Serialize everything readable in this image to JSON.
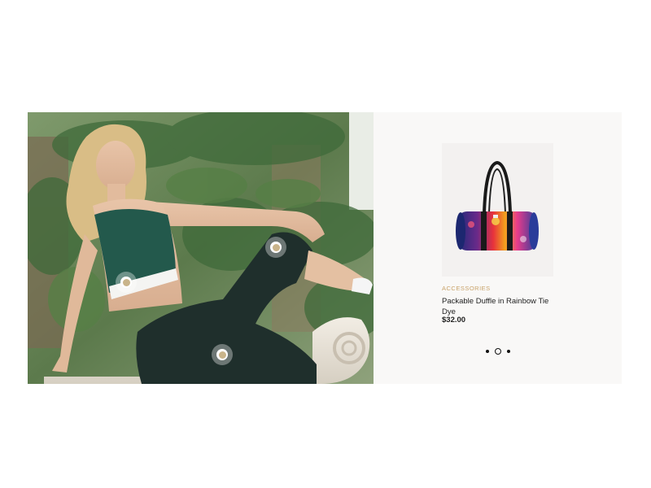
{
  "lookbook": {
    "image_alt": "Model sitting on a stone bench wearing a green sports bra and dark track pants",
    "hotspots": [
      {
        "name": "top-hotspot",
        "product": "sports bra"
      },
      {
        "name": "knee-hotspot",
        "product": "track pants"
      },
      {
        "name": "pants-hotspot",
        "product": "track pants"
      }
    ]
  },
  "product": {
    "category": "ACCESSORIES",
    "title": "Packable Duffle in Rainbow Tie Dye",
    "price": "$32.00"
  },
  "pager": {
    "count": 3,
    "active_index": 1
  },
  "colors": {
    "panel_bg": "#f9f8f7",
    "accent": "#c9a36a",
    "text": "#222222"
  }
}
